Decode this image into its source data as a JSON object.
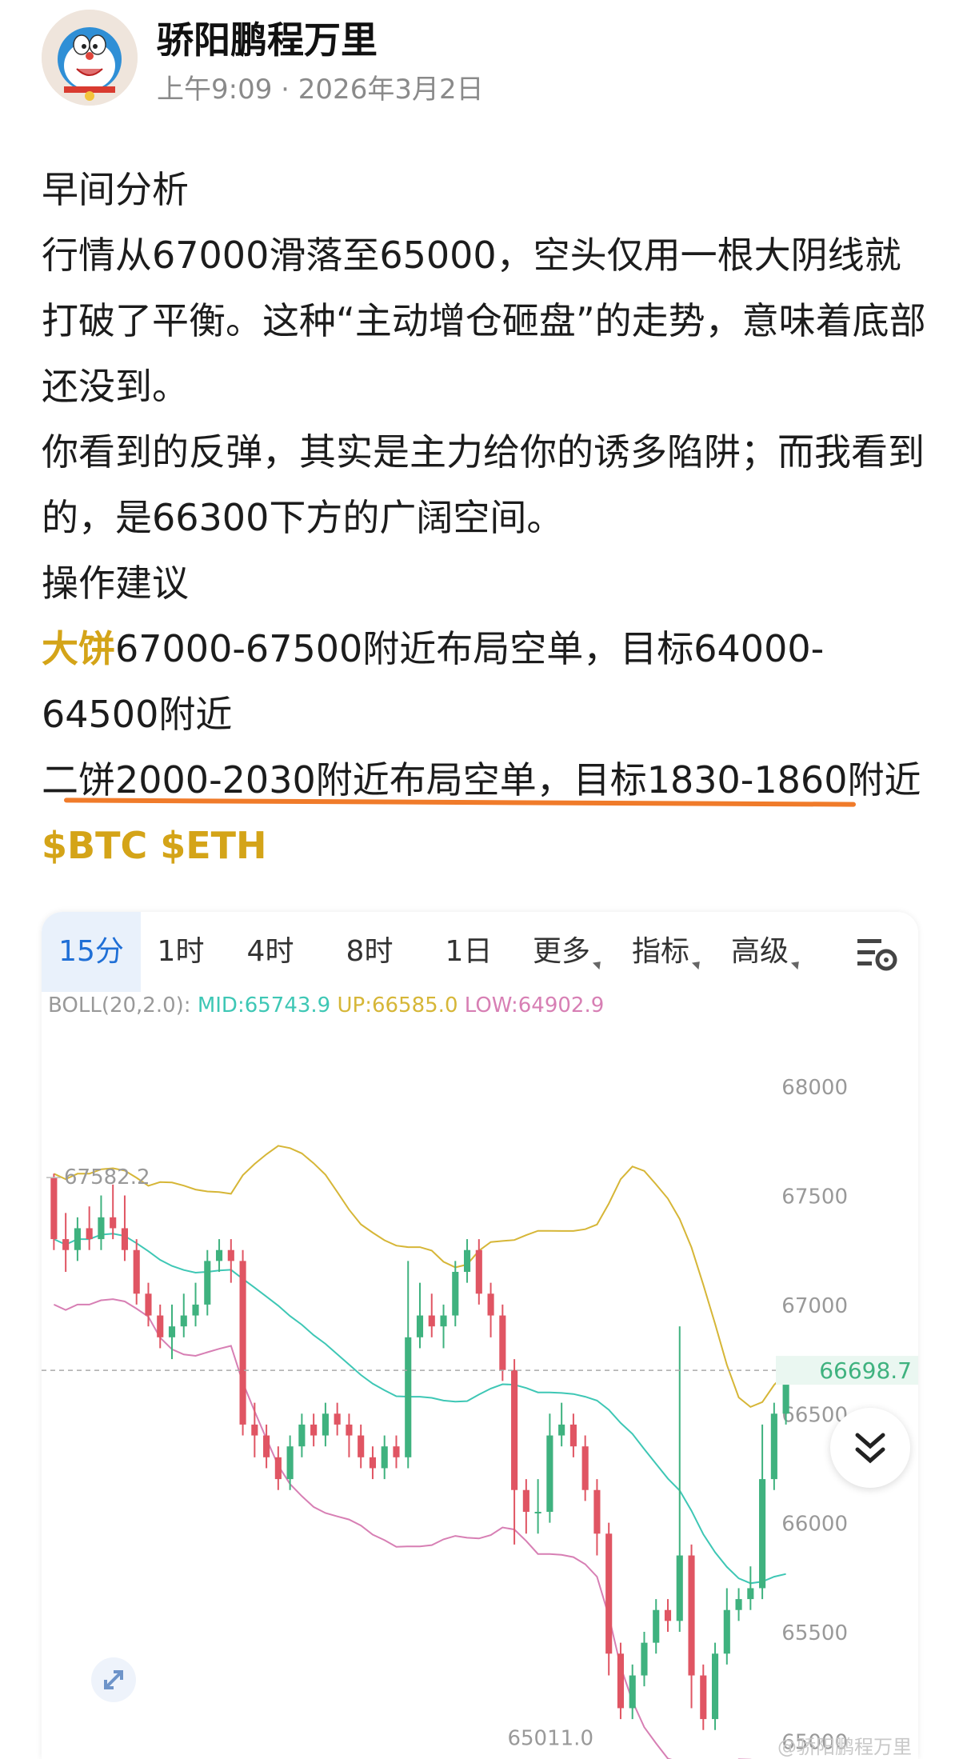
{
  "post": {
    "author": "骄阳鹏程万里",
    "time": "上午9:09",
    "date": "2026年3月2日",
    "paragraphs": [
      "早间分析",
      "行情从67000滑落至65000，空头仅用一根大阴线就打破了平衡。这种“主动增仓砸盘”的走势，意味着底部还没到。",
      "你看到的反弹，其实是主力给你的诱多陷阱；而我看到的，是66300下方的广阔空间。",
      "操作建议"
    ],
    "line_btc_label": "大饼",
    "line_btc_text": "67000-67500附近布局空单，目标64000-64500附近",
    "line_eth_label": "二饼",
    "line_eth_text": "2000-2030附近布局空单，目标1830-1860附近",
    "tags": "$BTC $ETH"
  },
  "chart_panel": {
    "tabs": [
      "15分",
      "1时",
      "4时",
      "8时",
      "1日",
      "更多",
      "指标",
      "高级"
    ],
    "active_tab": "15分",
    "settings_icon": "chart-settings-icon",
    "boll_label": "BOLL(20,2.0):",
    "boll_mid": "MID:65743.9",
    "boll_up": "UP:66585.0",
    "boll_low": "LOW:64902.9",
    "current_price": "66698.7",
    "high_marker": "67582.2",
    "low_marker": "65011.0",
    "watermark": "@骄阳鹏程万里",
    "scroll_down_icon": "double-chevron-down-icon",
    "expand_icon": "expand-icon"
  },
  "colors": {
    "up": "#3fb27f",
    "down": "#e05563",
    "boll_mid": "#3ec7b5",
    "boll_up": "#d6b637",
    "boll_low": "#d77fb4",
    "accent": "#1f6fd6",
    "underline": "#f07b2a"
  },
  "chart_data": {
    "type": "candlestick",
    "y_ticks": [
      68000,
      67500,
      67000,
      66500,
      66000,
      65500,
      65000
    ],
    "ylim": [
      64950,
      68250
    ],
    "candles": [
      [
        67580,
        67300,
        67600,
        67250
      ],
      [
        67300,
        67250,
        67420,
        67150
      ],
      [
        67250,
        67350,
        67400,
        67200
      ],
      [
        67350,
        67300,
        67450,
        67250
      ],
      [
        67300,
        67400,
        67500,
        67250
      ],
      [
        67400,
        67350,
        67550,
        67300
      ],
      [
        67350,
        67250,
        67500,
        67200
      ],
      [
        67250,
        67050,
        67300,
        67000
      ],
      [
        67050,
        66950,
        67100,
        66900
      ],
      [
        66950,
        66850,
        67000,
        66800
      ],
      [
        66850,
        66900,
        67000,
        66750
      ],
      [
        66900,
        66950,
        67050,
        66850
      ],
      [
        66950,
        67000,
        67100,
        66900
      ],
      [
        67000,
        67200,
        67250,
        66950
      ],
      [
        67200,
        67250,
        67300,
        67150
      ],
      [
        67250,
        67200,
        67300,
        67100
      ],
      [
        67200,
        66450,
        67250,
        66400
      ],
      [
        66450,
        66400,
        66550,
        66300
      ],
      [
        66400,
        66300,
        66450,
        66250
      ],
      [
        66300,
        66200,
        66350,
        66150
      ],
      [
        66200,
        66350,
        66400,
        66150
      ],
      [
        66350,
        66450,
        66500,
        66300
      ],
      [
        66450,
        66400,
        66500,
        66350
      ],
      [
        66400,
        66500,
        66550,
        66350
      ],
      [
        66500,
        66450,
        66550,
        66400
      ],
      [
        66450,
        66400,
        66500,
        66300
      ],
      [
        66400,
        66300,
        66450,
        66250
      ],
      [
        66300,
        66250,
        66350,
        66200
      ],
      [
        66250,
        66350,
        66400,
        66200
      ],
      [
        66350,
        66300,
        66400,
        66250
      ],
      [
        66300,
        66850,
        67200,
        66250
      ],
      [
        66850,
        66950,
        67100,
        66800
      ],
      [
        66950,
        66900,
        67050,
        66850
      ],
      [
        66900,
        66950,
        67000,
        66800
      ],
      [
        66950,
        67150,
        67200,
        66900
      ],
      [
        67150,
        67250,
        67300,
        67100
      ],
      [
        67250,
        67050,
        67300,
        67000
      ],
      [
        67050,
        66950,
        67100,
        66850
      ],
      [
        66950,
        66700,
        67000,
        66650
      ],
      [
        66700,
        66150,
        66750,
        65900
      ],
      [
        66150,
        66050,
        66200,
        65950
      ],
      [
        66050,
        66050,
        66200,
        65950
      ],
      [
        66050,
        66400,
        66500,
        66000
      ],
      [
        66400,
        66450,
        66550,
        66350
      ],
      [
        66450,
        66350,
        66500,
        66300
      ],
      [
        66350,
        66150,
        66400,
        66100
      ],
      [
        66150,
        65950,
        66200,
        65850
      ],
      [
        65950,
        65400,
        66000,
        65300
      ],
      [
        65400,
        65150,
        65450,
        65100
      ],
      [
        65150,
        65300,
        65350,
        65100
      ],
      [
        65300,
        65450,
        65500,
        65250
      ],
      [
        65450,
        65600,
        65650,
        65400
      ],
      [
        65600,
        65550,
        65650,
        65500
      ],
      [
        65550,
        65850,
        66900,
        65500
      ],
      [
        65850,
        65300,
        65900,
        65150
      ],
      [
        65300,
        65100,
        65350,
        65050
      ],
      [
        65100,
        65400,
        65450,
        65050
      ],
      [
        65400,
        65600,
        65700,
        65350
      ],
      [
        65600,
        65650,
        65700,
        65550
      ],
      [
        65650,
        65700,
        65800,
        65600
      ],
      [
        65700,
        66200,
        66450,
        65650
      ],
      [
        66200,
        66500,
        66550,
        66150
      ],
      [
        66500,
        66650,
        66750,
        66450
      ]
    ]
  }
}
